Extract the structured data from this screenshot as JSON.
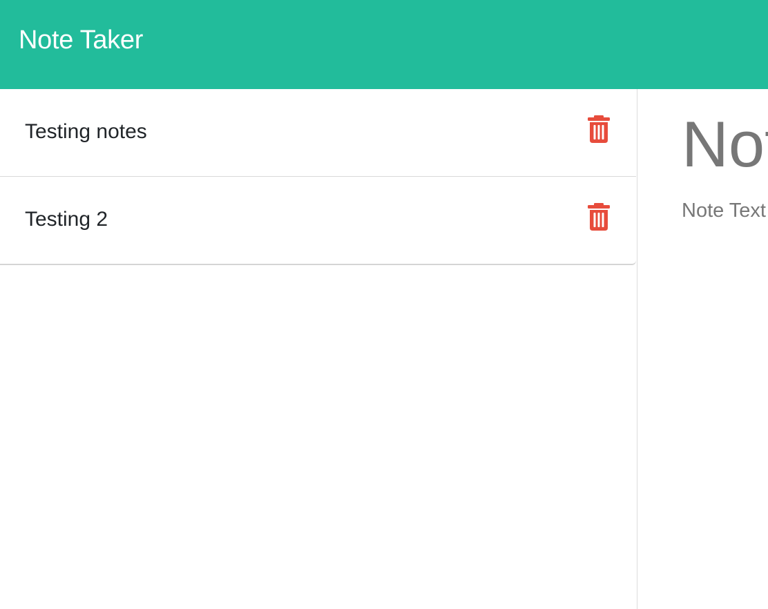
{
  "navbar": {
    "brand": "Note Taker",
    "background_color": "#22bc9b"
  },
  "notes": {
    "items": [
      {
        "title": "Testing notes",
        "delete_icon": "trash-icon"
      },
      {
        "title": "Testing 2",
        "delete_icon": "trash-icon"
      }
    ],
    "delete_color": "#e74c3c"
  },
  "editor": {
    "title_placeholder": "Note Title",
    "text_placeholder": "Note Text"
  }
}
